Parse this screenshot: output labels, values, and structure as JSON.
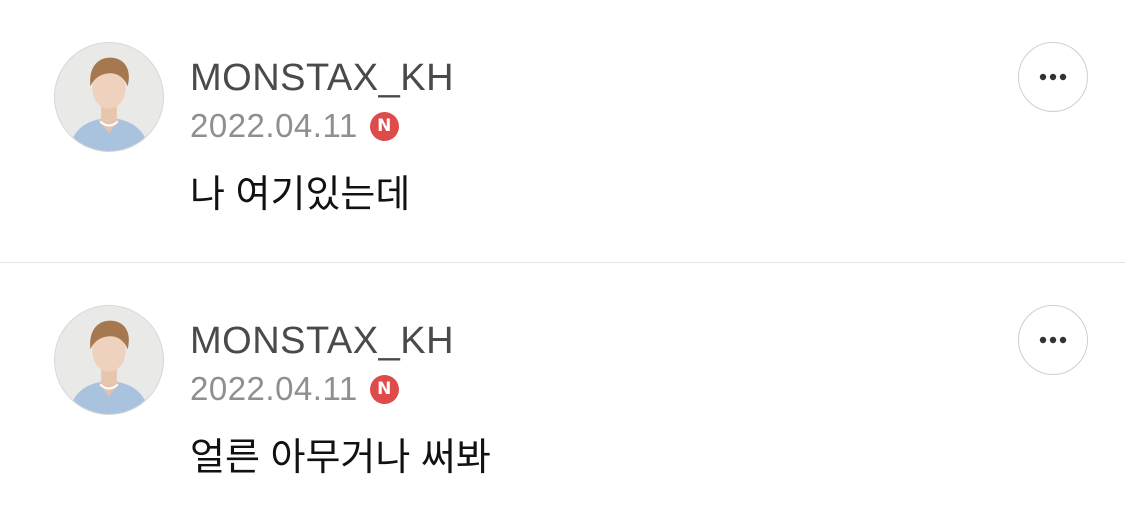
{
  "posts": [
    {
      "username": "MONSTAX_KH",
      "date": "2022.04.11",
      "badge": "N",
      "message": "나 여기있는데",
      "more_icon": "more-horizontal-icon"
    },
    {
      "username": "MONSTAX_KH",
      "date": "2022.04.11",
      "badge": "N",
      "message": "얼른 아무거나 써봐",
      "more_icon": "more-horizontal-icon"
    }
  ],
  "colors": {
    "badge": "#dd4b4b",
    "username": "#4a4a4a",
    "date": "#8f8f8f",
    "divider": "#e3e3e3"
  }
}
